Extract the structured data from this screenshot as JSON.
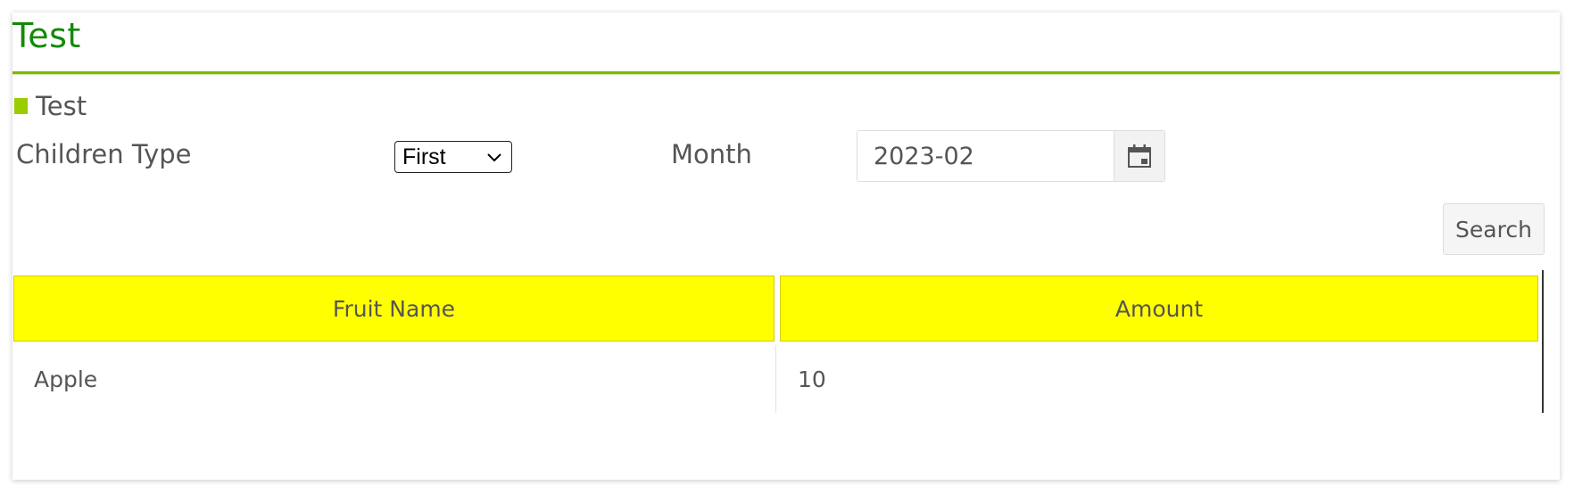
{
  "page": {
    "title": "Test"
  },
  "section": {
    "title": "Test"
  },
  "filters": {
    "children_type_label": "Children Type",
    "children_type_value": "First",
    "month_label": "Month",
    "month_value": "2023-02"
  },
  "buttons": {
    "search_label": "Search"
  },
  "table": {
    "columns": [
      "Fruit Name",
      "Amount"
    ],
    "rows": [
      [
        "Apple",
        "10"
      ]
    ],
    "header_color": "#ffff00"
  },
  "colors": {
    "title": "#138a07",
    "accent": "#9acd00"
  },
  "icons": {
    "calendar": "calendar-icon",
    "select_arrow": "chevron-down-icon"
  }
}
